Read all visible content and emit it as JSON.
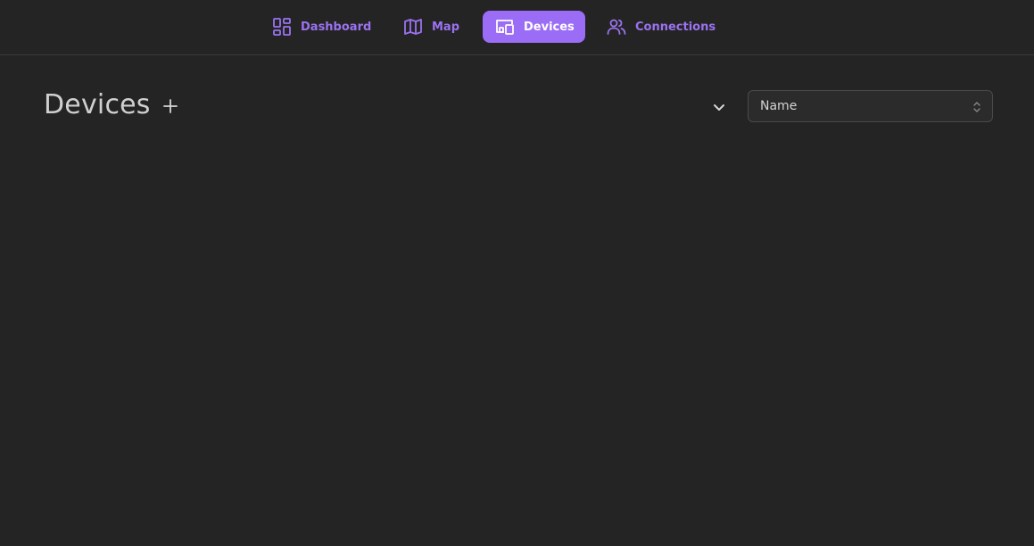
{
  "nav": {
    "items": [
      {
        "label": "Dashboard",
        "icon": "dashboard-icon"
      },
      {
        "label": "Map",
        "icon": "map-icon"
      },
      {
        "label": "Devices",
        "icon": "devices-icon",
        "active": true
      },
      {
        "label": "Connections",
        "icon": "users-icon"
      }
    ]
  },
  "main": {
    "title": "Devices",
    "add_icon": "plus-icon",
    "sort_toggle_icon": "chevron-down-icon",
    "sort_select": {
      "value": "Name"
    }
  },
  "colors": {
    "background": "#242424",
    "accent": "#9b6cf5",
    "nav_text": "#9b72f0"
  }
}
